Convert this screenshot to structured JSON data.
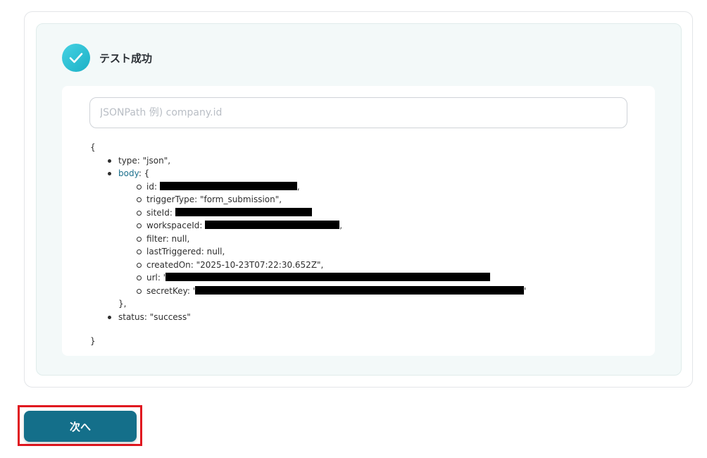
{
  "result": {
    "status_title": "テスト成功",
    "jsonpath": {
      "placeholder": "JSONPath 例) company.id",
      "value": ""
    }
  },
  "json_view": {
    "open_brace": "{",
    "close_brace": "}",
    "type_line": "type: \"json\",",
    "body_key": "body",
    "body_suffix": ": {",
    "fields": {
      "id_label": "id: ",
      "id_suffix": ",",
      "triggerType": "triggerType: \"form_submission\",",
      "siteId_label": "siteId: ",
      "workspaceId_label": "workspaceId: ",
      "workspaceId_suffix": ",",
      "filter": "filter: null,",
      "lastTriggered": "lastTriggered: null,",
      "createdOn": "createdOn: \"2025-10-23T07:22:30.652Z\",",
      "url_label": "url: '",
      "secretKey_label": "secretKey: '",
      "secretKey_suffix": "'"
    },
    "body_close": "},",
    "status_line": "status: \"success\""
  },
  "footer": {
    "next_label": "次へ"
  }
}
